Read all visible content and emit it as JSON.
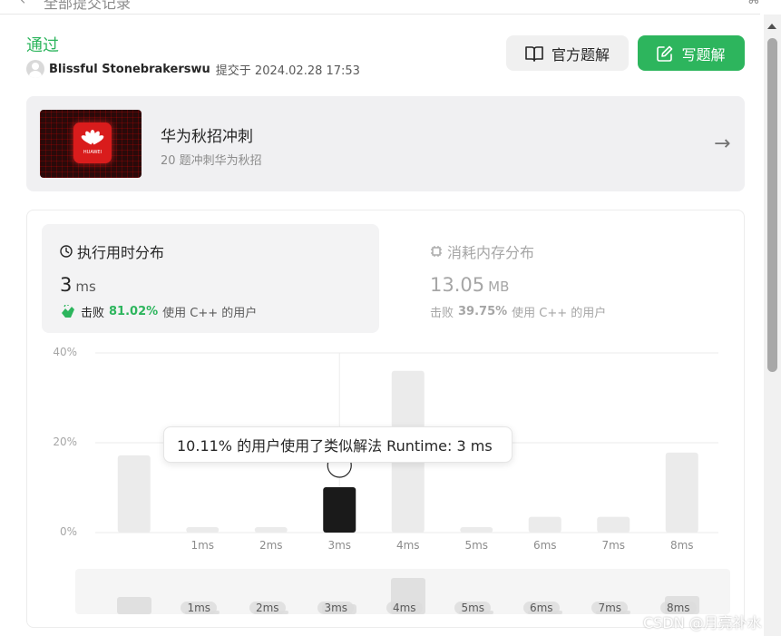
{
  "header": {
    "back_label": "全部提交记录"
  },
  "submission": {
    "status": "通过",
    "author": "Blissful Stonebrakerswu",
    "submitted_text": "提交于 2024.02.28 17:53"
  },
  "actions": {
    "official_label": "官方题解",
    "write_label": "写题解"
  },
  "promo": {
    "title": "华为秋招冲刺",
    "subtitle": "20 题冲刺华为秋招",
    "logo_text": "HUAWEI"
  },
  "runtime": {
    "title": "执行用时分布",
    "value": "3",
    "unit": "ms",
    "beat_prefix": "击败",
    "beat_pct": "81.02%",
    "beat_suffix": "使用 C++ 的用户"
  },
  "memory": {
    "title": "消耗内存分布",
    "value": "13.05",
    "unit": "MB",
    "beat_prefix": "击败",
    "beat_pct": "39.75%",
    "beat_suffix": "使用 C++ 的用户"
  },
  "tooltip": {
    "text": "10.11% 的用户使用了类似解法 Runtime: 3 ms"
  },
  "chart_data": {
    "type": "bar",
    "categories": [
      "",
      "1ms",
      "2ms",
      "3ms",
      "4ms",
      "5ms",
      "6ms",
      "7ms",
      "8ms"
    ],
    "values": [
      17.2,
      1.2,
      1.2,
      10.11,
      36.0,
      1.2,
      3.5,
      3.5,
      17.8
    ],
    "highlight_index": 3,
    "yticks": [
      "40%",
      "20%",
      "0%"
    ],
    "ylim": [
      0,
      40
    ],
    "colors": {
      "bar": "#ebebeb",
      "highlight": "#1a1a1a",
      "grid": "#ebebeb"
    }
  },
  "brush": {
    "labels": [
      "1ms",
      "2ms",
      "3ms",
      "4ms",
      "5ms",
      "6ms",
      "7ms",
      "8ms"
    ]
  },
  "watermark": "CSDN @月亮补水"
}
